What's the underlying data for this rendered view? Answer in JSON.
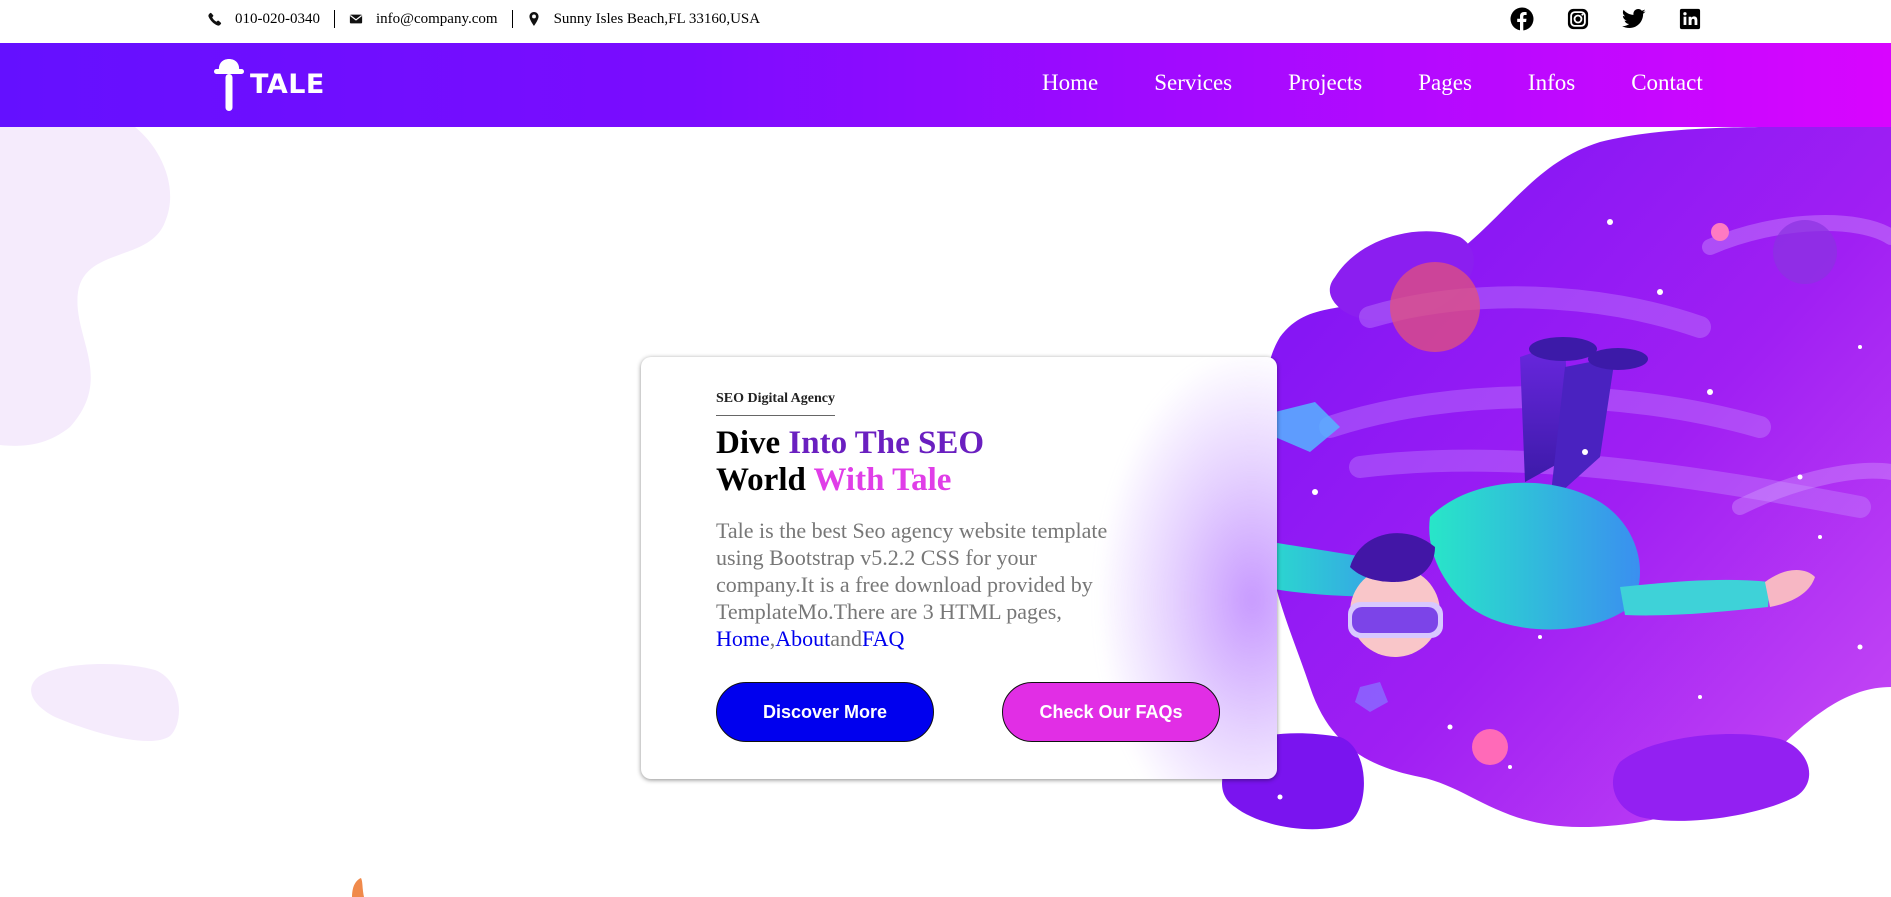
{
  "topbar": {
    "phone": "010-020-0340",
    "email": "info@company.com",
    "address": "Sunny Isles Beach,FL 33160,USA",
    "icons": [
      "phone-icon",
      "envelope-icon",
      "map-pin-icon"
    ],
    "socials": [
      "facebook-icon",
      "instagram-icon",
      "twitter-icon",
      "linkedin-icon"
    ]
  },
  "nav": {
    "logo_text": "TALE",
    "items": [
      "Home",
      "Services",
      "Projects",
      "Pages",
      "Infos",
      "Contact"
    ]
  },
  "hero": {
    "eyebrow": "SEO Digital Agency",
    "headline": {
      "line1_a": "Dive ",
      "line1_b": "Into The SEO",
      "line2_a": "World ",
      "line2_b": "With Tale"
    },
    "description": "Tale is the best Seo agency website template using Bootstrap v5.2.2 CSS for your company.It is a free download provided by TemplateMo.There are 3 HTML pages, ",
    "links": [
      "Home",
      ",",
      "About",
      "and",
      "FAQ"
    ],
    "buttons": {
      "discover": "Discover More",
      "faqs": "Check Our FAQs"
    }
  },
  "colors": {
    "nav_gradient_start": "#6410ff",
    "nav_gradient_end": "#d805ff",
    "headline_purple": "#6a1fc0",
    "headline_pink": "#e03ee8",
    "button_blue": "#0000ee",
    "button_pink": "#e12ee5",
    "link_blue": "#0000ee"
  }
}
